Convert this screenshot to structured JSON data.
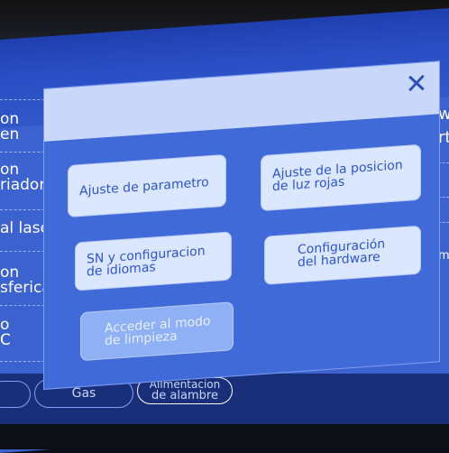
{
  "left_menu": [
    {
      "line1": "on",
      "line2": "en"
    },
    {
      "line1": "on",
      "line2": "riador"
    },
    {
      "line1": "al laser",
      "line2": ""
    },
    {
      "line1": "on",
      "line2": "sferica"
    },
    {
      "line1": "o",
      "line2": "C"
    }
  ],
  "right_side": {
    "top1": "w",
    "top2": "rt",
    "mid": "m"
  },
  "dialog": {
    "close_glyph": "✕",
    "options": [
      {
        "label": "Ajuste de parametro",
        "line2": ""
      },
      {
        "label": "Ajuste de la posicion",
        "line2": "de luz rojas"
      },
      {
        "label": "SN y configuracion",
        "line2": "de idiomas"
      },
      {
        "label": "Configuración",
        "line2": "del hardware"
      },
      {
        "label": "Acceder al modo",
        "line2": "de limpieza"
      }
    ]
  },
  "bottom_bar": {
    "gas": "Gas",
    "feed_line1": "Alimentacion",
    "feed_line2": "de alambre"
  },
  "colors": {
    "screen": "#3c62cf",
    "dialog": "#3f6ad8",
    "button": "#dbe6ff",
    "button_text": "#2d55c9"
  }
}
